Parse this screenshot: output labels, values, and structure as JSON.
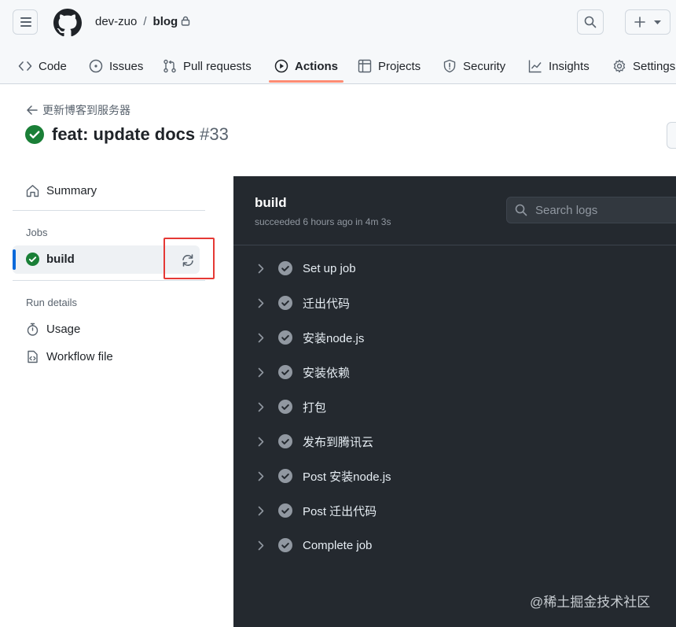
{
  "header": {
    "owner": "dev-zuo",
    "separator": "/",
    "repo": "blog",
    "icons": [
      "hamburger-icon",
      "github-logo-icon",
      "lock-icon",
      "search-icon",
      "plus-icon",
      "triangle-down-icon"
    ]
  },
  "tabs": [
    {
      "label": "Code",
      "icon": "code-icon"
    },
    {
      "label": "Issues",
      "icon": "issue-icon"
    },
    {
      "label": "Pull requests",
      "icon": "pull-request-icon"
    },
    {
      "label": "Actions",
      "icon": "play-icon",
      "active": true
    },
    {
      "label": "Projects",
      "icon": "table-icon"
    },
    {
      "label": "Security",
      "icon": "shield-icon"
    },
    {
      "label": "Insights",
      "icon": "graph-icon"
    },
    {
      "label": "Settings",
      "icon": "gear-icon"
    }
  ],
  "run": {
    "back_label": "更新博客到服务器",
    "title": "feat: update docs",
    "number": "#33",
    "status": "success"
  },
  "sidebar": {
    "summary_label": "Summary",
    "jobs_heading": "Jobs",
    "job_label": "build",
    "run_details_heading": "Run details",
    "usage_label": "Usage",
    "workflow_file_label": "Workflow file"
  },
  "log": {
    "job_name": "build",
    "status_line": "succeeded 6 hours ago in 4m 3s",
    "search_placeholder": "Search logs",
    "steps": [
      "Set up job",
      "迁出代码",
      "安装node.js",
      "安装依赖",
      "打包",
      "发布到腾讯云",
      "Post 安装node.js",
      "Post 迁出代码",
      "Complete job"
    ]
  },
  "watermark": "@稀土掘金技术社区",
  "colors": {
    "success": "#1a7f37",
    "active_tab_underline": "#fd8c73",
    "log_background": "#24292f",
    "highlight_box": "#e53935",
    "selected_job_bar": "#0969da"
  }
}
